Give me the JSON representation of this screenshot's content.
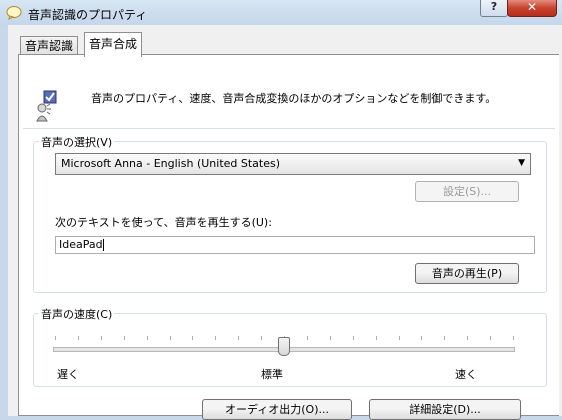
{
  "window": {
    "title": "音声認識のプロパティ",
    "help_label": "?",
    "close_label": "✕"
  },
  "tabs": [
    {
      "label": "音声認識",
      "active": false
    },
    {
      "label": "音声合成",
      "active": true
    }
  ],
  "intro_text": "音声のプロパティ、速度、音声合成変換のほかのオプションなどを制御できます。",
  "voice_selection": {
    "group_label": "音声の選択(V)",
    "selected_voice": "Microsoft Anna - English (United States)",
    "settings_button": "設定(S)...",
    "settings_enabled": false,
    "preview_label": "次のテキストを使って、音声を再生する(U):",
    "preview_text": "IdeaPad",
    "play_button": "音声の再生(P)"
  },
  "speed": {
    "group_label": "音声の速度(C)",
    "slow_label": "遅く",
    "normal_label": "標準",
    "fast_label": "速く",
    "value": 0.5,
    "tick_count": 21
  },
  "buttons": {
    "audio_output": "オーディオ出力(O)...",
    "advanced": "詳細設定(D)..."
  },
  "colors": {
    "title_bar": "#c8d8ea",
    "close_button": "#c8432e",
    "panel": "#ffffff",
    "face": "#f0f0f0"
  }
}
